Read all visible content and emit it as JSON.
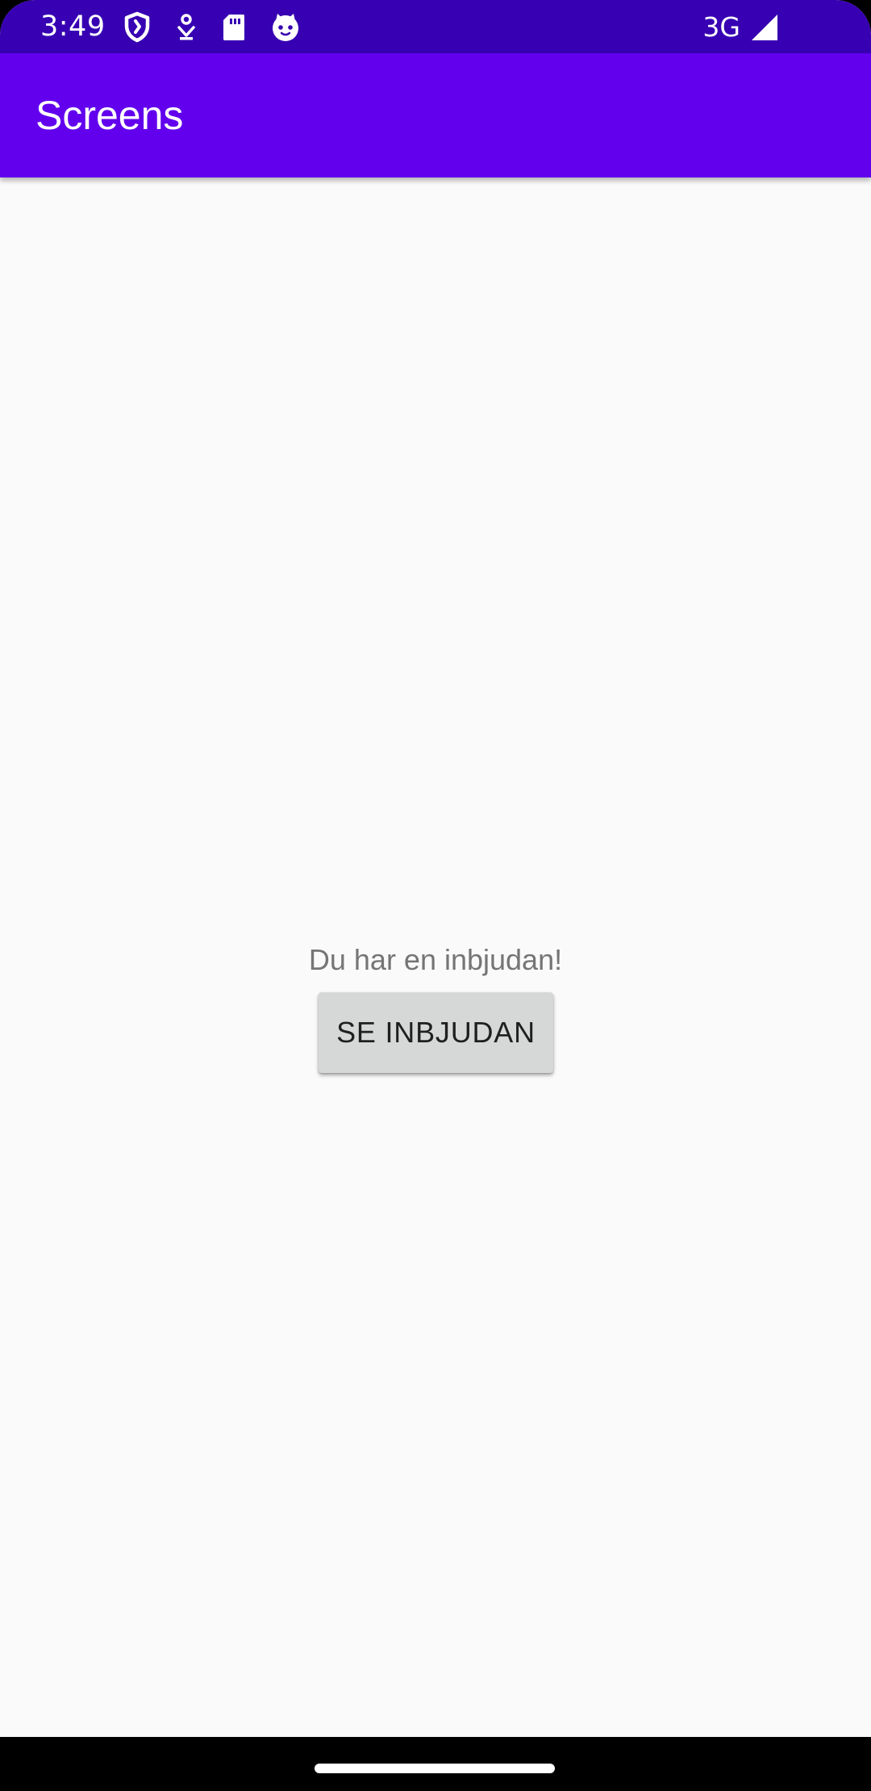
{
  "status_bar": {
    "time": "3:49",
    "network": "3G",
    "icons_left": [
      "shield-icon",
      "download-icon",
      "sd-card-icon",
      "cat-face-icon"
    ],
    "icons_right": [
      "signal-icon"
    ]
  },
  "app_bar": {
    "title": "Screens"
  },
  "main": {
    "message": "Du har en inbjudan!",
    "button_label": "SE INBJUDAN"
  },
  "colors": {
    "status_bar": "#3700b3",
    "app_bar": "#6200ee",
    "background": "#fafafa",
    "button": "#d6d7d7",
    "message_text": "#757575"
  }
}
